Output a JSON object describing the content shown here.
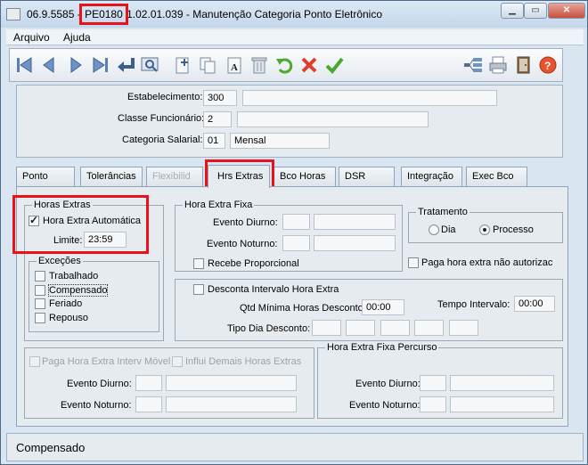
{
  "window": {
    "version": "06.9.5585",
    "program": "PE0180",
    "build": "1.02.01.039",
    "title": "Manutenção Categoria Ponto Eletrônico",
    "sep": "-"
  },
  "menu": {
    "arquivo": "Arquivo",
    "ajuda": "Ajuda"
  },
  "toolbar": {
    "icons": [
      "first-icon",
      "prev-icon",
      "next-icon",
      "last-icon",
      "goto-icon",
      "search-icon",
      "new-icon",
      "copy-icon",
      "edit-icon",
      "delete-icon",
      "undo-icon",
      "cancel-icon",
      "ok-icon",
      "tree-icon",
      "print-icon",
      "exit-icon",
      "help-icon"
    ]
  },
  "header": {
    "estabelecimento_label": "Estabelecimento:",
    "estabelecimento_value": "300",
    "estabelecimento_desc": "",
    "classe_label": "Classe Funcionário:",
    "classe_value": "2",
    "classe_desc": "",
    "categoria_label": "Categoria Salarial:",
    "categoria_value": "01",
    "categoria_desc": "Mensal"
  },
  "tabs": [
    "Ponto",
    "Tolerâncias",
    "Flexibilid",
    "Hrs Extras",
    "Bco Horas",
    "DSR",
    "Integração",
    "Exec Bco"
  ],
  "active_tab": "Hrs Extras",
  "horas_extras": {
    "title": "Horas Extras",
    "automatica_label": "Hora Extra Automática",
    "automatica_checked": true,
    "limite_label": "Limite:",
    "limite_value": "23:59"
  },
  "excecoes": {
    "title": "Exceções",
    "items": [
      "Trabalhado",
      "Compensado",
      "Feriado",
      "Repouso"
    ]
  },
  "hora_extra_fixa": {
    "title": "Hora Extra Fixa",
    "diurno_label": "Evento Diurno:",
    "noturno_label": "Evento Noturno:",
    "proporcional_label": "Recebe Proporcional"
  },
  "tratamento": {
    "title": "Tratamento",
    "dia_label": "Dia",
    "processo_label": "Processo",
    "selected": "Processo"
  },
  "paga_nao_autorizada_label": "Paga hora extra não autorizac",
  "intervalo": {
    "desconta_label": "Desconta Intervalo Hora Extra",
    "qtd_label": "Qtd Mínima Horas Desconto:",
    "qtd_value": "00:00",
    "tempo_label": "Tempo Intervalo:",
    "tempo_value": "00:00",
    "tipo_label": "Tipo Dia Desconto:"
  },
  "interv_movel": {
    "paga_label": "Paga Hora Extra Interv Móvel",
    "influi_label": "Influi Demais Horas Extras",
    "diurno_label": "Evento Diurno:",
    "noturno_label": "Evento Noturno:"
  },
  "percurso": {
    "title": "Hora Extra Fixa Percurso",
    "diurno_label": "Evento Diurno:",
    "noturno_label": "Evento Noturno:"
  },
  "status": {
    "text": "Compensado"
  }
}
